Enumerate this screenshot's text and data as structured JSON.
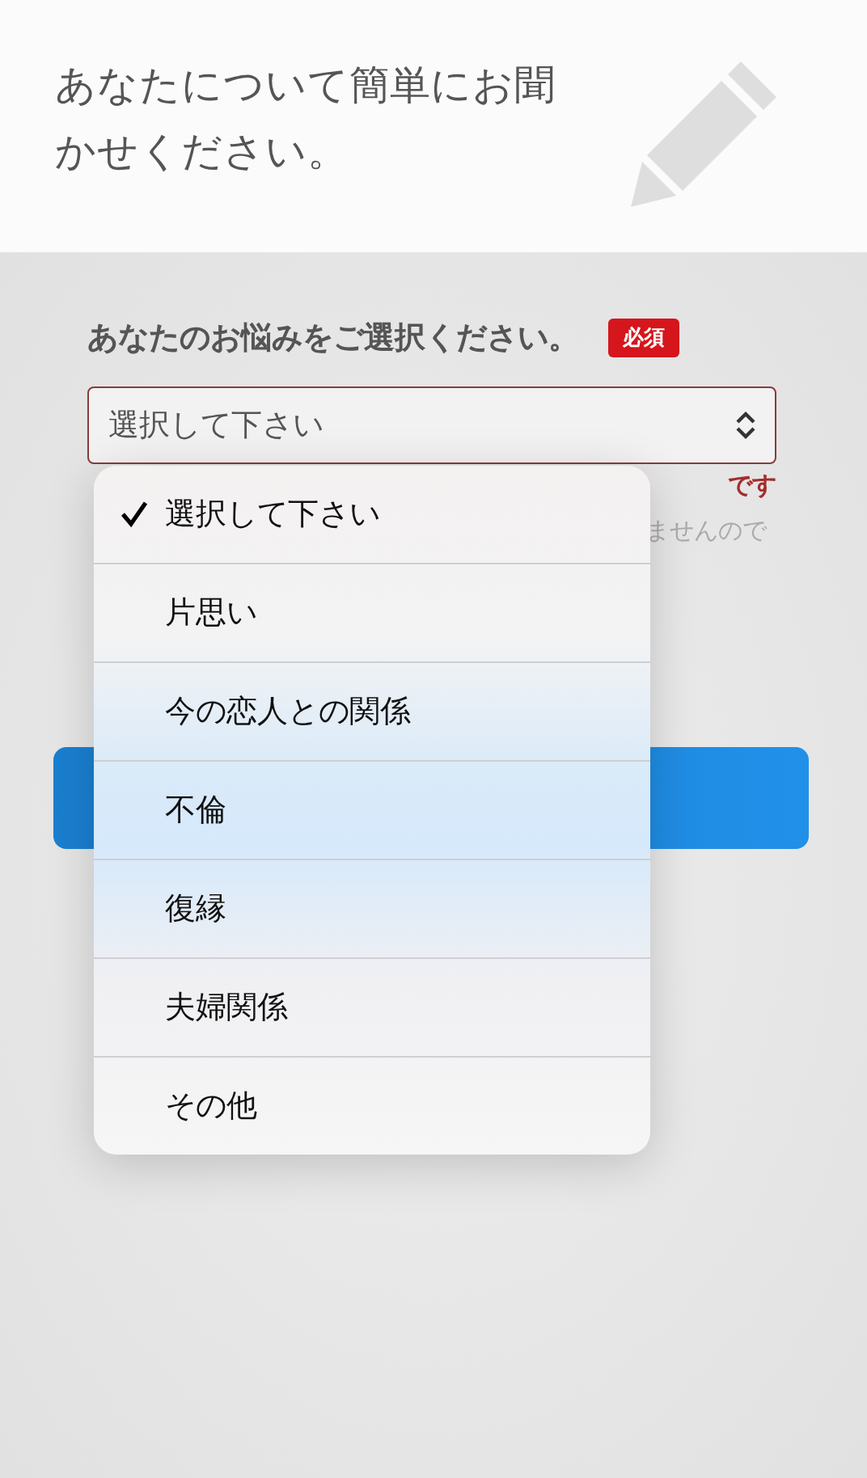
{
  "header": {
    "title": "あなたについて簡単にお聞かせください。"
  },
  "question": {
    "label": "あなたのお悩みをご選択ください。",
    "badge": "必須"
  },
  "select": {
    "value": "選択して下さい"
  },
  "error_fragments": [
    "です"
  ],
  "hint_fragments": [
    "ませんので"
  ],
  "menu": {
    "options": [
      {
        "label": "選択して下さい",
        "selected": true
      },
      {
        "label": "片思い",
        "selected": false
      },
      {
        "label": "今の恋人との関係",
        "selected": false
      },
      {
        "label": "不倫",
        "selected": false
      },
      {
        "label": "復縁",
        "selected": false
      },
      {
        "label": "夫婦関係",
        "selected": false
      },
      {
        "label": "その他",
        "selected": false
      }
    ]
  }
}
